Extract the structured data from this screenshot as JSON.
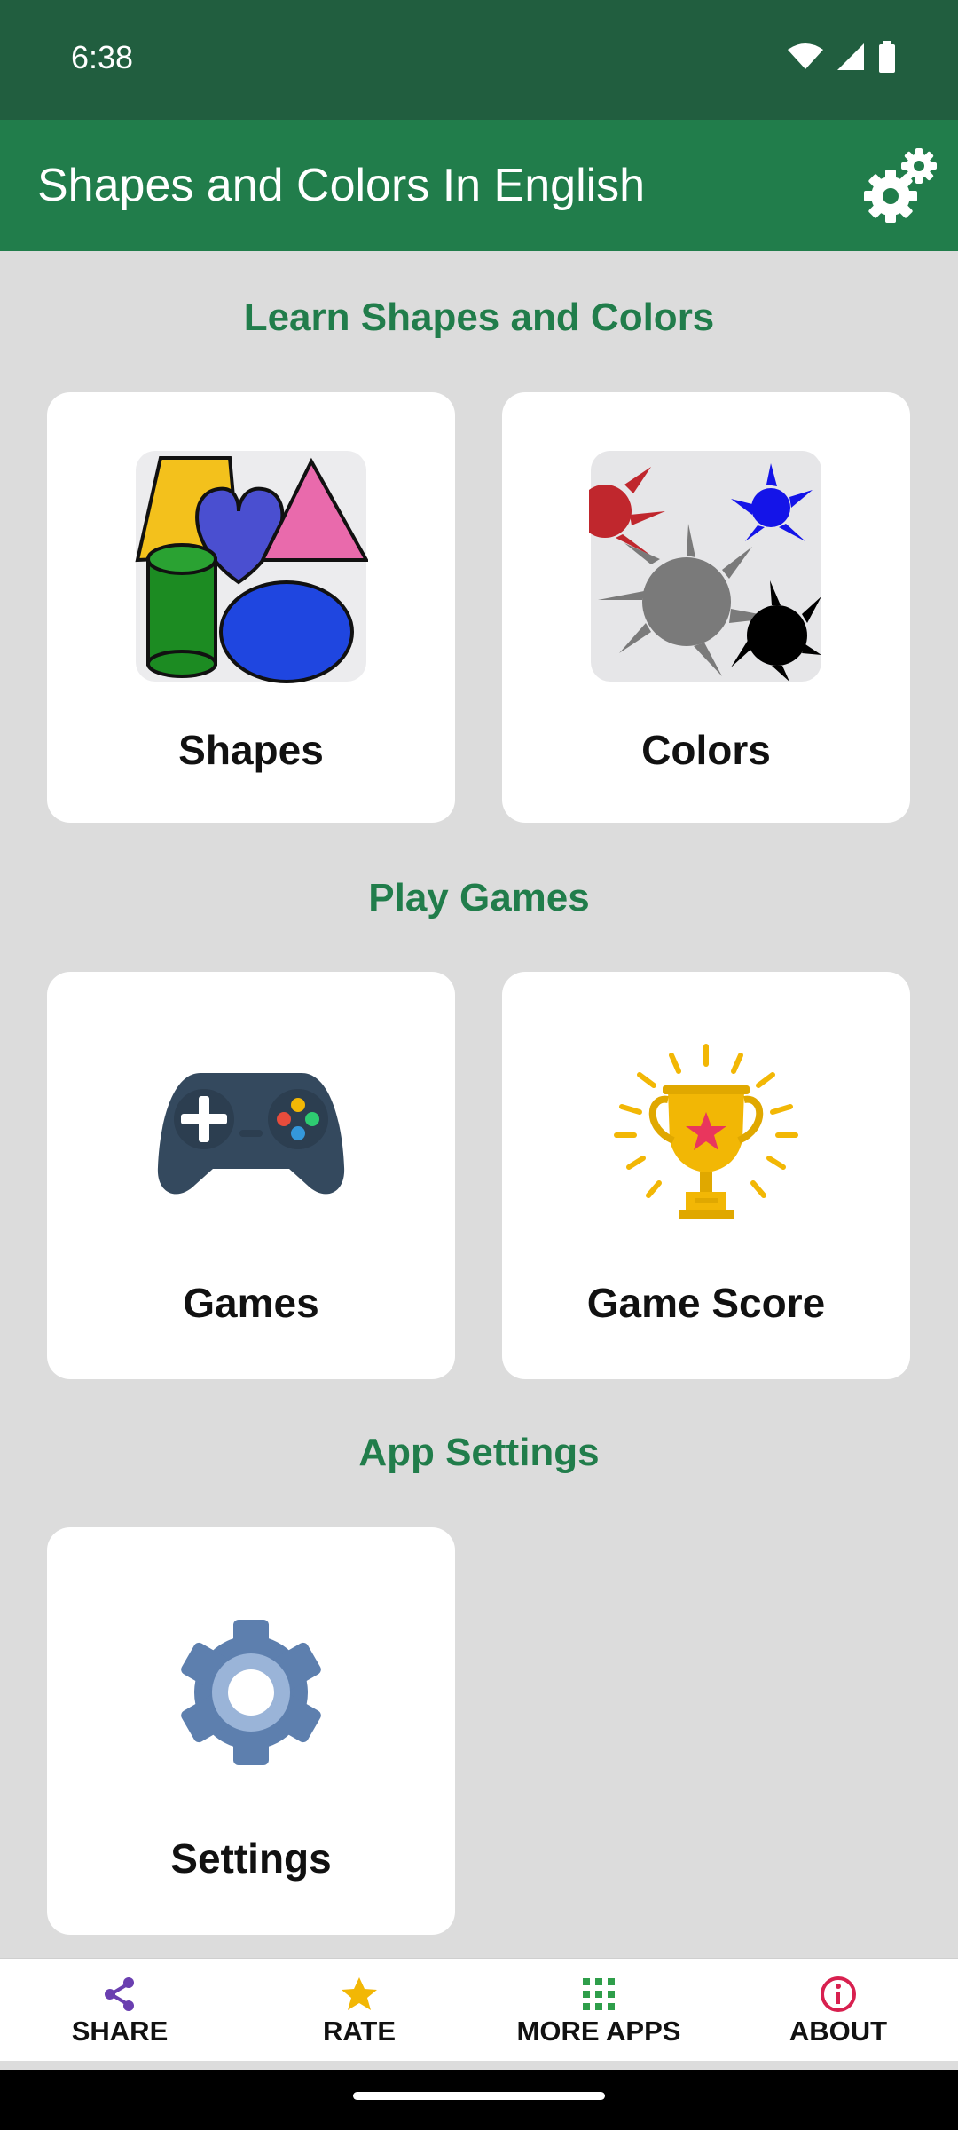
{
  "status_bar": {
    "time": "6:38"
  },
  "app_bar": {
    "title": "Shapes and Colors In English"
  },
  "sections": {
    "learn": "Learn Shapes and Colors",
    "play": "Play Games",
    "settings": "App Settings"
  },
  "cards": {
    "shapes": "Shapes",
    "colors": "Colors",
    "games": "Games",
    "game_score": "Game Score",
    "settings": "Settings"
  },
  "bottom_nav": {
    "share": "SHARE",
    "rate": "RATE",
    "more_apps": "MORE APPS",
    "about": "ABOUT"
  },
  "colors": {
    "status_bar": "#215e3f",
    "app_bar": "#217d4b",
    "accent": "#217d4b",
    "background": "#dcdcdc",
    "share_icon": "#6a3fb0",
    "rate_icon": "#f2b705",
    "more_apps_icon": "#2e9e4a",
    "about_icon": "#d8204f"
  },
  "icons": {
    "app_bar": "gears-icon",
    "share": "share-icon",
    "rate": "star-icon",
    "more_apps": "grid-icon",
    "about": "info-icon"
  }
}
